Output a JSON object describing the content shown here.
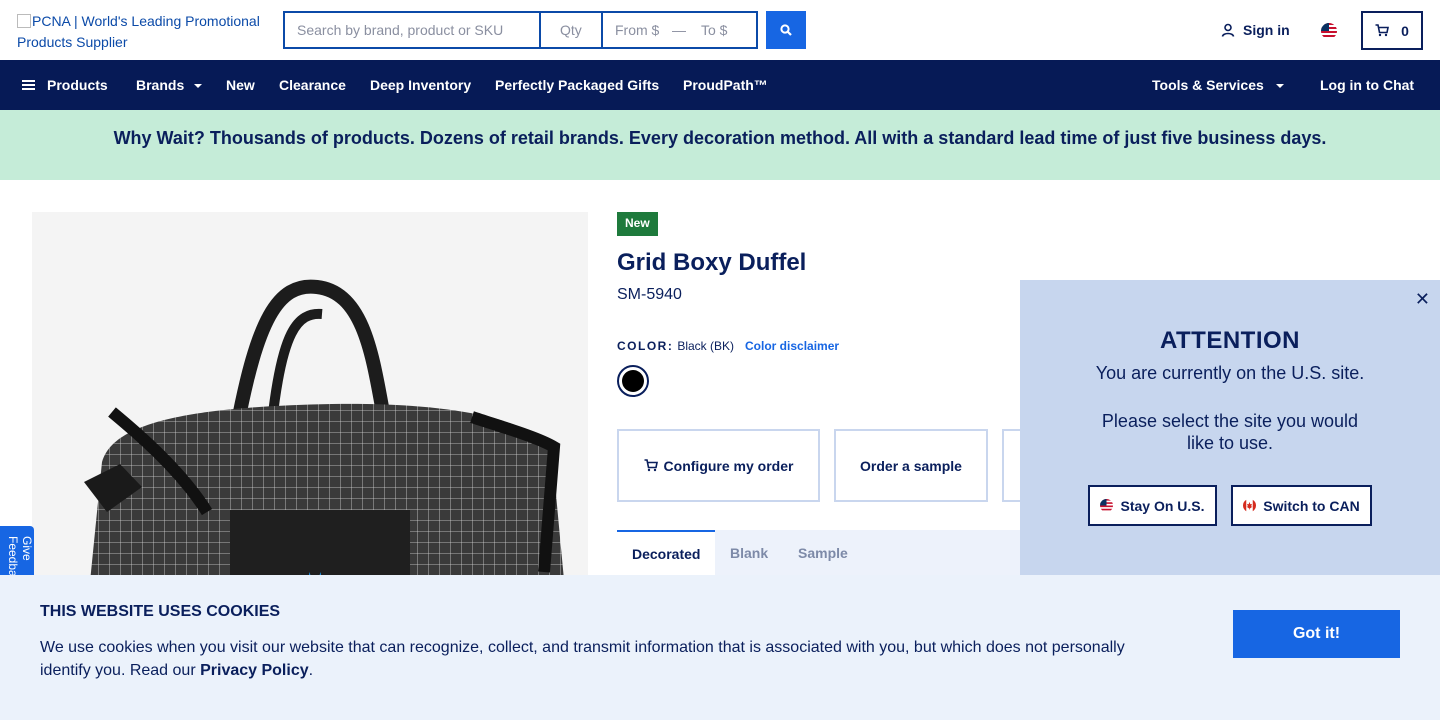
{
  "header": {
    "logo_alt": "PCNA | World's Leading Promotional Products Supplier",
    "search_placeholder": "Search by brand, product or SKU",
    "qty_placeholder": "Qty",
    "from_placeholder": "From $",
    "range_dash": "—",
    "to_placeholder": "To $",
    "signin_label": "Sign in",
    "cart_count": "0"
  },
  "nav": {
    "items": [
      "Products",
      "Brands",
      "New",
      "Clearance",
      "Deep Inventory",
      "Perfectly Packaged Gifts",
      "ProudPath™"
    ],
    "tools_label": "Tools & Services",
    "chat_label": "Log in to Chat"
  },
  "banner": {
    "text": "Why Wait? Thousands of products. Dozens of retail brands. Every decoration method. All with a standard lead time of just five business days."
  },
  "product": {
    "badge": "New",
    "title": "Grid Boxy Duffel",
    "sku": "SM-5940",
    "color_label": "COLOR:",
    "color_value": "Black (BK)",
    "color_disclaimer": "Color disclaimer",
    "swatch_color": "#000000",
    "actions": [
      "Configure my order",
      "Order a sample"
    ],
    "tabs": [
      "Decorated",
      "Blank",
      "Sample"
    ]
  },
  "feedback": {
    "label": "Give Feedback"
  },
  "region_modal": {
    "title": "ATTENTION",
    "line1": "You are currently on the U.S. site.",
    "line2": "Please select the site you would like to use.",
    "stay_label": "Stay On U.S.",
    "switch_label": "Switch to CAN"
  },
  "cookie": {
    "title": "THIS WEBSITE USES COOKIES",
    "message": "We use cookies when you visit our website that can recognize, collect, and transmit information that is associated with you, but which does not personally identify you. Read our ",
    "link": "Privacy Policy",
    "period": ".",
    "button": "Got it!"
  },
  "colors": {
    "navy": "#061a56",
    "brand_blue": "#1766e3",
    "banner_green": "#c5ecd8",
    "badge_green": "#1e7a3c",
    "modal_bg": "#c7d6ee",
    "cookie_bg": "#ebf2fb"
  }
}
